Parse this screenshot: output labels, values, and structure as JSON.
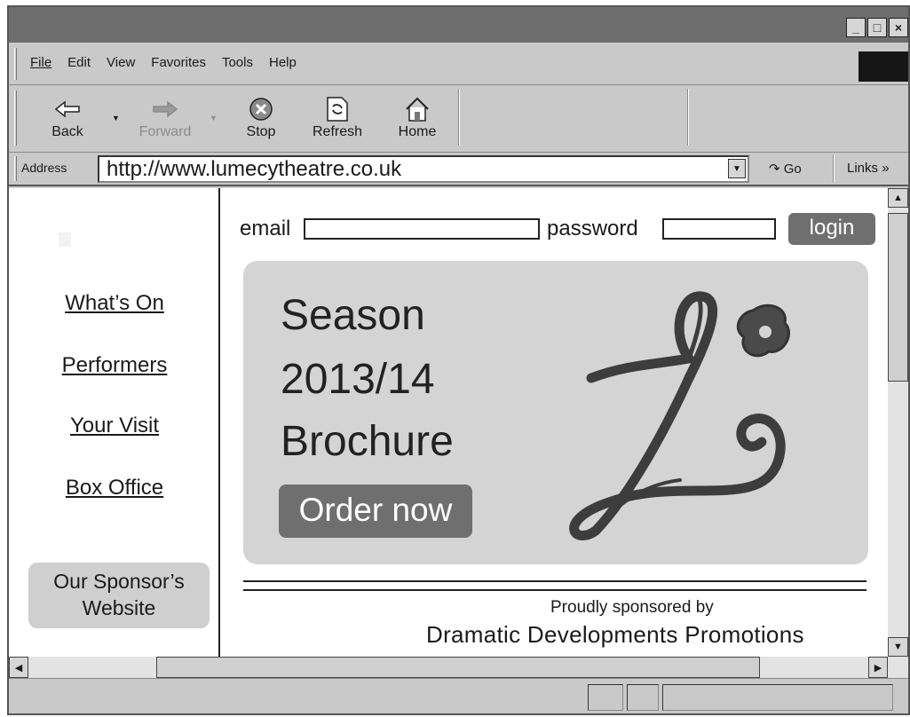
{
  "window": {
    "controls": [
      "_",
      "□",
      "×"
    ]
  },
  "menu": {
    "items": [
      {
        "label": "File",
        "accel": "F"
      },
      {
        "label": "Edit",
        "accel": "E"
      },
      {
        "label": "View",
        "accel": "V"
      },
      {
        "label": "Favorites",
        "accel": "a"
      },
      {
        "label": "Tools",
        "accel": "T"
      },
      {
        "label": "Help",
        "accel": "H"
      }
    ]
  },
  "toolbar": {
    "back": "Back",
    "forward": "Forward",
    "stop": "Stop",
    "refresh": "Refresh",
    "home": "Home"
  },
  "address": {
    "label": "Address",
    "url": "http://www.lumecytheatre.co.uk",
    "go": "Go",
    "links": "Links"
  },
  "page": {
    "nav": [
      "What’s On",
      "Performers",
      "Your Visit",
      "Box Office"
    ],
    "sponsor_button": "Our Sponsor’s Website",
    "login": {
      "email_label": "email",
      "password_label": "password",
      "button": "login"
    },
    "banner": {
      "lines": [
        "Season",
        "2013/14",
        "Brochure"
      ],
      "cta": "Order now"
    },
    "footer": {
      "sponsored_by": "Proudly sponsored by",
      "sponsor_name": "Dramatic Developments Promotions"
    }
  }
}
